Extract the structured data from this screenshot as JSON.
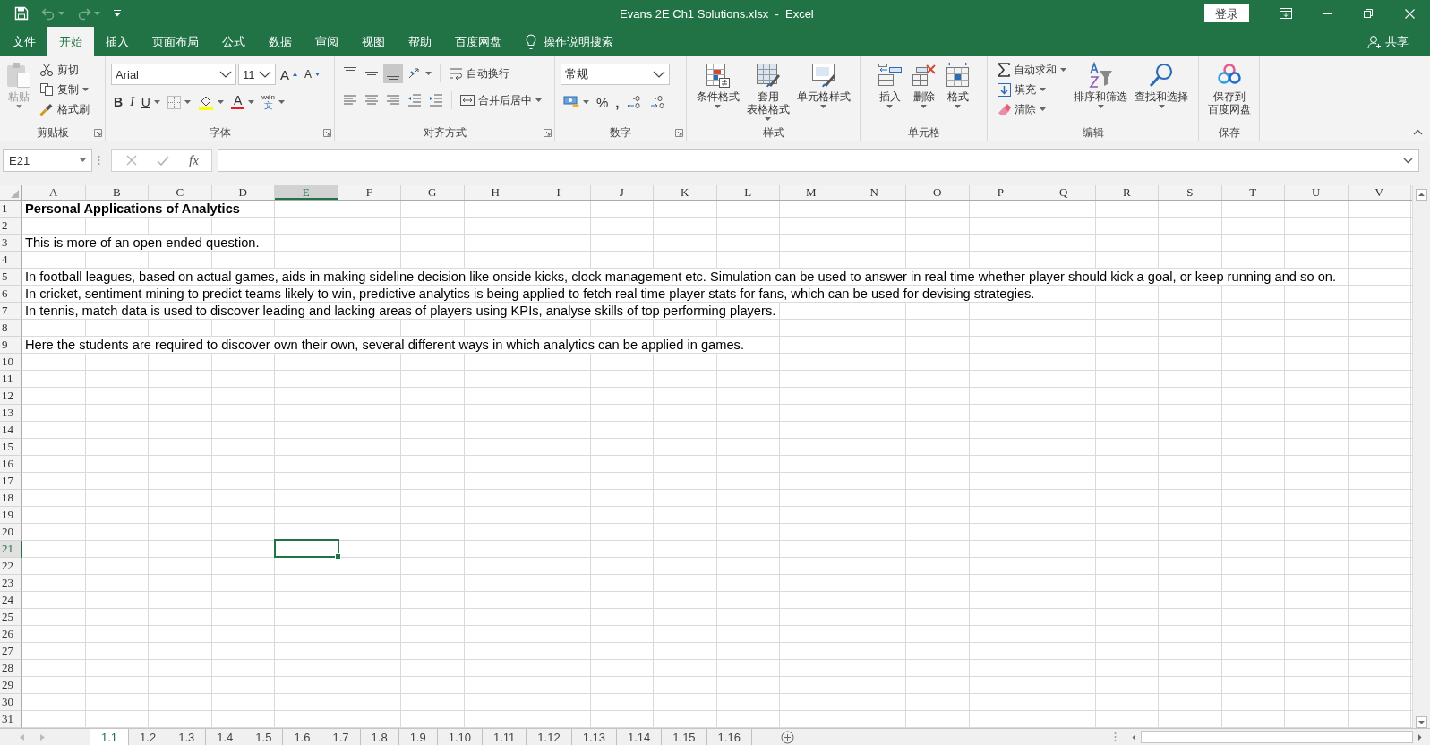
{
  "quick_access": [
    {
      "kind": "save",
      "disabled": false
    },
    {
      "kind": "undo",
      "disabled": true
    },
    {
      "kind": "redo",
      "disabled": true
    },
    {
      "kind": "customize",
      "disabled": false
    }
  ],
  "window": {
    "title": "Evans 2E Ch1 Solutions.xlsx  -  Excel",
    "login": "登录"
  },
  "menu_tabs": [
    {
      "label": "文件",
      "selected": false
    },
    {
      "label": "开始",
      "selected": true
    },
    {
      "label": "插入",
      "selected": false
    },
    {
      "label": "页面布局",
      "selected": false
    },
    {
      "label": "公式",
      "selected": false
    },
    {
      "label": "数据",
      "selected": false
    },
    {
      "label": "审阅",
      "selected": false
    },
    {
      "label": "视图",
      "selected": false
    },
    {
      "label": "帮助",
      "selected": false
    },
    {
      "label": "百度网盘",
      "selected": false
    }
  ],
  "tell_me": "操作说明搜索",
  "share": "共享",
  "ribbon": [
    {
      "kind": "clipboard",
      "label": "剪贴板",
      "paste": {
        "label": "粘贴",
        "disabled": true
      },
      "commands": [
        "剪切",
        "复制",
        "格式刷"
      ]
    },
    {
      "kind": "font",
      "label": "字体",
      "font_name": "Arial",
      "font_size": "11",
      "grow": "A",
      "shrink": "A",
      "styles": [
        "B",
        "I",
        "U"
      ],
      "font_color_label": "A",
      "phonetic": [
        "wén",
        "文"
      ]
    },
    {
      "kind": "alignment",
      "label": "对齐方式",
      "vertical": [
        {
          "selected": false
        },
        {
          "selected": false
        },
        {
          "selected": true
        }
      ],
      "wrap": "自动换行",
      "merge": "合并后居中"
    },
    {
      "kind": "number",
      "label": "数字",
      "format": "常规",
      "percent": "%",
      "comma": ","
    },
    {
      "kind": "styles",
      "label": "样式",
      "buttons": [
        {
          "lines": [
            "条件格式"
          ]
        },
        {
          "lines": [
            "套用",
            "表格格式"
          ]
        },
        {
          "lines": [
            "单元格样式"
          ]
        }
      ]
    },
    {
      "kind": "cells",
      "label": "单元格",
      "buttons": [
        {
          "lines": [
            "插入"
          ]
        },
        {
          "lines": [
            "删除"
          ]
        },
        {
          "lines": [
            "格式"
          ]
        }
      ]
    },
    {
      "kind": "editing",
      "label": "编辑",
      "commands": [
        "自动求和",
        "填充",
        "清除"
      ],
      "buttons": [
        {
          "lines": [
            "排序和筛选"
          ]
        },
        {
          "lines": [
            "查找和选择"
          ]
        }
      ]
    },
    {
      "kind": "save",
      "label": "保存",
      "buttons": [
        {
          "lines": [
            "保存到",
            "百度网盘"
          ]
        }
      ]
    }
  ],
  "formula_bar": {
    "name_box": "E21",
    "function_label": "fx"
  },
  "columns": [
    {
      "label": "A",
      "selected": false
    },
    {
      "label": "B",
      "selected": false
    },
    {
      "label": "C",
      "selected": false
    },
    {
      "label": "D",
      "selected": false
    },
    {
      "label": "E",
      "selected": true
    },
    {
      "label": "F",
      "selected": false
    },
    {
      "label": "G",
      "selected": false
    },
    {
      "label": "H",
      "selected": false
    },
    {
      "label": "I",
      "selected": false
    },
    {
      "label": "J",
      "selected": false
    },
    {
      "label": "K",
      "selected": false
    },
    {
      "label": "L",
      "selected": false
    },
    {
      "label": "M",
      "selected": false
    },
    {
      "label": "N",
      "selected": false
    },
    {
      "label": "O",
      "selected": false
    },
    {
      "label": "P",
      "selected": false
    },
    {
      "label": "Q",
      "selected": false
    },
    {
      "label": "R",
      "selected": false
    },
    {
      "label": "S",
      "selected": false
    },
    {
      "label": "T",
      "selected": false
    },
    {
      "label": "U",
      "selected": false
    },
    {
      "label": "V",
      "selected": false
    }
  ],
  "rows": [
    {
      "number": "1",
      "selected": false,
      "text": "Personal Applications of Analytics",
      "bold": true
    },
    {
      "number": "2",
      "selected": false
    },
    {
      "number": "3",
      "selected": false,
      "text": "This is more of an open ended question.",
      "bold": false
    },
    {
      "number": "4",
      "selected": false
    },
    {
      "number": "5",
      "selected": false,
      "text": "In football leagues, based on actual games, aids in making sideline decision like onside kicks, clock management etc. Simulation can be used to answer in real time whether player should kick a goal, or keep running and so on.",
      "bold": false
    },
    {
      "number": "6",
      "selected": false,
      "text": "In cricket, sentiment mining to predict teams likely to win, predictive analytics is being applied to fetch real time player stats for fans, which can be used for devising strategies.",
      "bold": false
    },
    {
      "number": "7",
      "selected": false,
      "text": "In tennis, match data is used to discover leading and lacking areas of players using KPIs, analyse skills of top performing players.",
      "bold": false
    },
    {
      "number": "8",
      "selected": false
    },
    {
      "number": "9",
      "selected": false,
      "text": "Here the students are required to discover own their own, several different ways in which analytics can be applied in games.",
      "bold": false
    },
    {
      "number": "10",
      "selected": false
    },
    {
      "number": "11",
      "selected": false
    },
    {
      "number": "12",
      "selected": false
    },
    {
      "number": "13",
      "selected": false
    },
    {
      "number": "14",
      "selected": false
    },
    {
      "number": "15",
      "selected": false
    },
    {
      "number": "16",
      "selected": false
    },
    {
      "number": "17",
      "selected": false
    },
    {
      "number": "18",
      "selected": false
    },
    {
      "number": "19",
      "selected": false
    },
    {
      "number": "20",
      "selected": false
    },
    {
      "number": "21",
      "selected": true
    },
    {
      "number": "22",
      "selected": false
    },
    {
      "number": "23",
      "selected": false
    },
    {
      "number": "24",
      "selected": false
    },
    {
      "number": "25",
      "selected": false
    },
    {
      "number": "26",
      "selected": false
    },
    {
      "number": "27",
      "selected": false
    },
    {
      "number": "28",
      "selected": false
    },
    {
      "number": "29",
      "selected": false
    },
    {
      "number": "30",
      "selected": false
    },
    {
      "number": "31",
      "selected": false
    }
  ],
  "sheet_tabs": [
    {
      "label": "1.1",
      "selected": true
    },
    {
      "label": "1.2",
      "selected": false
    },
    {
      "label": "1.3",
      "selected": false
    },
    {
      "label": "1.4",
      "selected": false
    },
    {
      "label": "1.5",
      "selected": false
    },
    {
      "label": "1.6",
      "selected": false
    },
    {
      "label": "1.7",
      "selected": false
    },
    {
      "label": "1.8",
      "selected": false
    },
    {
      "label": "1.9",
      "selected": false
    },
    {
      "label": "1.10",
      "selected": false
    },
    {
      "label": "1.11",
      "selected": false
    },
    {
      "label": "1.12",
      "selected": false
    },
    {
      "label": "1.13",
      "selected": false
    },
    {
      "label": "1.14",
      "selected": false
    },
    {
      "label": "1.15",
      "selected": false
    },
    {
      "label": "1.16",
      "selected": false
    }
  ]
}
